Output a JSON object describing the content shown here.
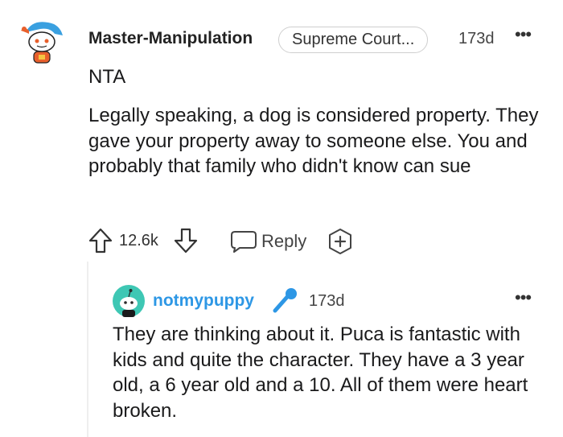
{
  "comment": {
    "author": "Master-Manipulation",
    "flair": "Supreme Court...",
    "time": "173d",
    "more": "•••",
    "title": "NTA",
    "body": "Legally speaking, a dog is considered property. They gave your property away to someone else. You and probably that family who didn't know can sue",
    "score": "12.6k",
    "reply_label": "Reply",
    "icons": {
      "upvote": "arrow-up-icon",
      "downvote": "arrow-down-icon",
      "reply": "speech-bubble-icon",
      "award": "award-plus-icon"
    }
  },
  "reply": {
    "author": "notmypuppy",
    "time": "173d",
    "more": "•••",
    "body": "They are thinking about it. Puca is fantastic with kids and quite the character. They have a 3 year old, a 6 year old and a 10. All of them were heart broken.",
    "author_color": "#2d97e5",
    "icons": {
      "badge": "microphone-icon"
    }
  }
}
